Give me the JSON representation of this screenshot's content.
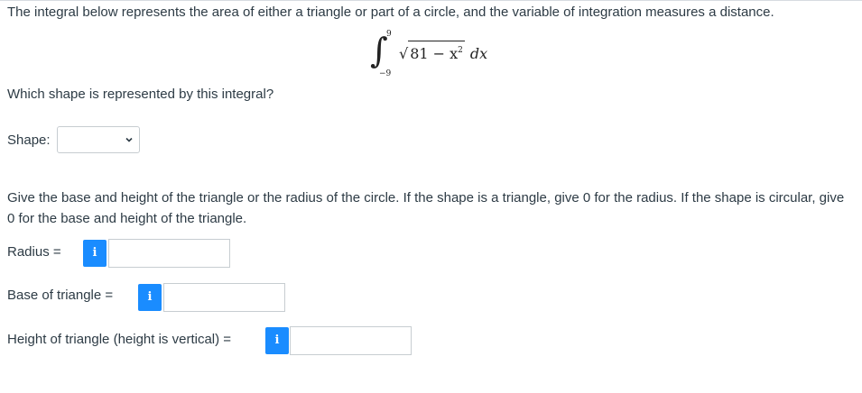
{
  "intro": "The integral below represents the area of either a triangle or part of a circle, and the variable of integration measures a distance.",
  "integral": {
    "upper": "9",
    "lower": "−9",
    "radicand_base": "81 − x",
    "exponent": "2",
    "differential": "dx"
  },
  "question": "Which shape is represented by this integral?",
  "shape": {
    "label": "Shape:",
    "selected": ""
  },
  "instructions": "Give the base and height of the triangle or the radius of the circle. If the shape is a triangle, give 0 for the radius. If the shape is circular, give 0 for the base and height of the triangle.",
  "radius": {
    "label": "Radius  =",
    "info": "i",
    "value": ""
  },
  "base": {
    "label": "Base of triangle  =",
    "info": "i",
    "value": ""
  },
  "height": {
    "label": "Height of triangle (height is vertical)  =",
    "info": "i",
    "value": ""
  },
  "colors": {
    "info_button": "#1a8cff",
    "text": "#2d3b45",
    "border": "#c7cdd1"
  }
}
